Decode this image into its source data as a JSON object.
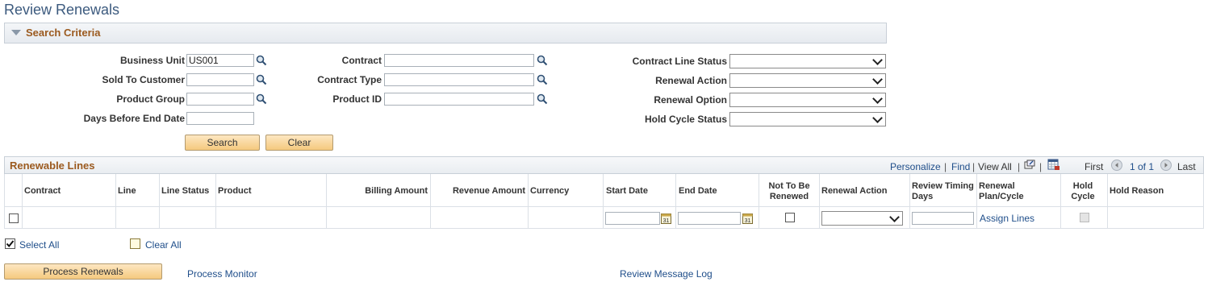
{
  "page": {
    "title": "Review Renewals"
  },
  "search": {
    "header": "Search Criteria",
    "business_unit": {
      "label": "Business Unit",
      "value": "US001"
    },
    "sold_to_customer": {
      "label": "Sold To Customer",
      "value": ""
    },
    "product_group": {
      "label": "Product Group",
      "value": ""
    },
    "days_before_end_date": {
      "label": "Days Before End Date",
      "value": ""
    },
    "contract": {
      "label": "Contract",
      "value": ""
    },
    "contract_type": {
      "label": "Contract Type",
      "value": ""
    },
    "product_id": {
      "label": "Product ID",
      "value": ""
    },
    "contract_line_status": {
      "label": "Contract Line Status",
      "value": ""
    },
    "renewal_action": {
      "label": "Renewal Action",
      "value": ""
    },
    "renewal_option": {
      "label": "Renewal Option",
      "value": ""
    },
    "hold_cycle_status": {
      "label": "Hold Cycle Status",
      "value": ""
    },
    "search_label": "Search",
    "clear_label": "Clear"
  },
  "grid": {
    "title": "Renewable Lines",
    "nav": {
      "personalize": "Personalize",
      "find": "Find",
      "view_all": "View All",
      "first": "First",
      "page_count": "1 of 1",
      "last": "Last"
    },
    "columns": {
      "contract": "Contract",
      "line": "Line",
      "line_status": "Line Status",
      "product": "Product",
      "billing_amount": "Billing Amount",
      "revenue_amount": "Revenue Amount",
      "currency": "Currency",
      "start_date": "Start Date",
      "end_date": "End Date",
      "not_to_be_renewed": "Not To Be Renewed",
      "renewal_action": "Renewal Action",
      "review_timing_days": "Review Timing Days",
      "renewal_plan_cycle": "Renewal Plan/Cycle",
      "hold_cycle": "Hold Cycle",
      "hold_reason": "Hold Reason"
    },
    "row": {
      "start_date": "",
      "end_date": "",
      "review_timing_days": "",
      "assign_lines": "Assign Lines"
    }
  },
  "footer": {
    "select_all": "Select All",
    "clear_all": "Clear All",
    "process_renewals": "Process Renewals",
    "process_monitor": "Process Monitor",
    "review_message_log": "Review Message Log"
  },
  "colors": {
    "title_blue": "#3c5a7e",
    "section_orange": "#9b5a1f",
    "link_blue": "#1f4e8a",
    "button_fill": "#f5c97e"
  }
}
